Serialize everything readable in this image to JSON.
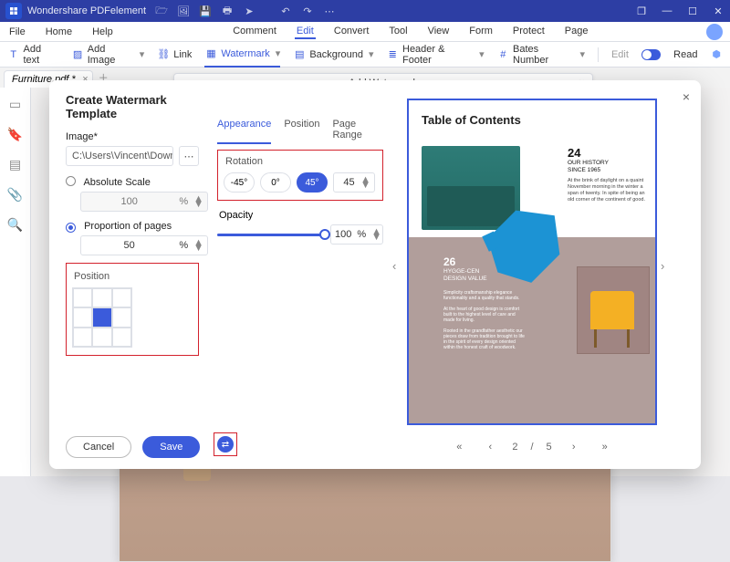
{
  "app": {
    "title": "Wondershare PDFelement"
  },
  "menubar": {
    "file": "File",
    "home": "Home",
    "help": "Help",
    "comment": "Comment",
    "edit": "Edit",
    "convert": "Convert",
    "tool": "Tool",
    "view": "View",
    "form": "Form",
    "protect": "Protect",
    "page": "Page"
  },
  "ribbon": {
    "add_text": "Add text",
    "add_image": "Add Image",
    "link": "Link",
    "watermark": "Watermark",
    "background": "Background",
    "header_footer": "Header & Footer",
    "bates_number": "Bates Number",
    "edit": "Edit",
    "read": "Read"
  },
  "document_tab": {
    "name": "Furniture.pdf *"
  },
  "aw_bar": {
    "title": "Add Watermark"
  },
  "dialog": {
    "title": "Create Watermark Template",
    "image_label": "Image*",
    "image_path": "C:\\Users\\Vincent\\Downloads\\good.",
    "absolute_scale": "Absolute Scale",
    "absolute_value": "100",
    "proportion": "Proportion of pages",
    "proportion_value": "50",
    "unit_percent": "%",
    "position_label": "Position",
    "cancel": "Cancel",
    "save": "Save",
    "tabs": {
      "appearance": "Appearance",
      "position": "Position",
      "pagerange": "Page Range"
    },
    "rotation_label": "Rotation",
    "rotation": {
      "m45": "-45°",
      "zero": "0°",
      "p45": "45°",
      "value": "45"
    },
    "opacity_label": "Opacity",
    "opacity_value": "100"
  },
  "preview": {
    "title": "Table of Contents",
    "n24": "24",
    "n24_sub": "OUR HISTORY\nSINCE 1965",
    "n26": "26",
    "n26_sub": "HYGGE-CEN\nDESIGN VALUE",
    "pager": {
      "page": "2",
      "sep": "/",
      "total": "5"
    }
  }
}
